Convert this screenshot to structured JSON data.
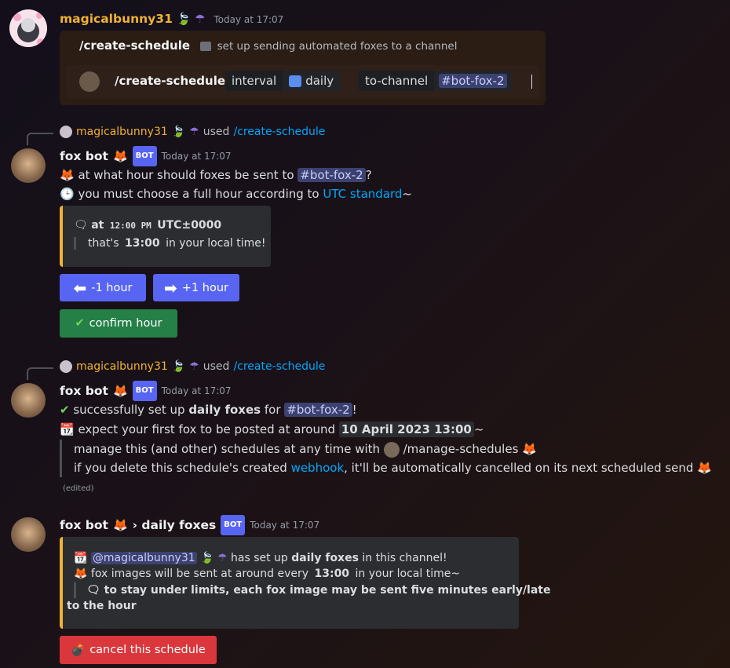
{
  "msg1": {
    "username": "magicalbunny31",
    "time": "Today at 17:07",
    "command": {
      "name": "/create-schedule",
      "description": "set up sending automated foxes to a channel",
      "input_command": "/create-schedule",
      "opt1_name": "interval",
      "opt1_value": "daily",
      "opt2_name": "to-channel",
      "opt2_value": "#bot-fox-2"
    }
  },
  "reply": {
    "username": "magicalbunny31",
    "used": "used",
    "command": "/create-schedule"
  },
  "msg2": {
    "username": "fox bot",
    "bot_tag": "BOT",
    "time": "Today at 17:07",
    "line1_a": "at what hour should foxes be sent to",
    "channel": "#bot-fox-2",
    "line1_b": "?",
    "line2_a": "you must choose a full hour according to",
    "line2_link": "UTC standard",
    "line2_b": "~",
    "embed": {
      "at": "at",
      "time": "12:00 PM",
      "tz": "UTC±0000",
      "local_a": "that's",
      "local_time": "13:00",
      "local_b": "in your local time!"
    },
    "btn_minus": "-1 hour",
    "btn_plus": "+1 hour",
    "btn_confirm": "confirm hour"
  },
  "msg3": {
    "username": "fox bot",
    "bot_tag": "BOT",
    "time": "Today at 17:07",
    "l1_a": "successfully set up",
    "l1_bold": "daily foxes",
    "l1_b": "for",
    "channel": "#bot-fox-2",
    "l1_c": "!",
    "l2_a": "expect your first fox to be posted at around",
    "l2_date": "10 April 2023 13:00",
    "l2_b": "~",
    "q1_a": "manage this (and other) schedules at any time with",
    "q1_cmd": "/manage-schedules",
    "q2_a": "if you delete this schedule's created",
    "q2_link": "webhook",
    "q2_b": ", it'll be automatically cancelled on its next scheduled send",
    "edited": "(edited)"
  },
  "msg4": {
    "username": "fox bot",
    "thread": "› daily foxes",
    "bot_tag": "BOT",
    "time": "Today at 17:07",
    "embed": {
      "mention": "@magicalbunny31",
      "l1_a": "has set up",
      "l1_bold": "daily foxes",
      "l1_b": "in this channel!",
      "l2_a": "fox images will be sent at around every",
      "l2_time": "13:00",
      "l2_b": "in your local time~",
      "q1": "to stay under limits, each fox image may be sent five minutes early/late",
      "q2": "to the hour"
    },
    "btn_cancel": "cancel this schedule"
  },
  "colors": {
    "bunny": "#f0b232",
    "blurple": "#5865f2",
    "green": "#248046",
    "red": "#da373c",
    "embed_bar": "#f0b232"
  },
  "icons": [
    "leaf-icon",
    "umbrella-icon",
    "fox-emoji-icon",
    "clock-icon",
    "speech-bubble-icon",
    "arrow-left-icon",
    "arrow-right-icon",
    "check-icon",
    "calendar-icon",
    "bomb-icon"
  ]
}
